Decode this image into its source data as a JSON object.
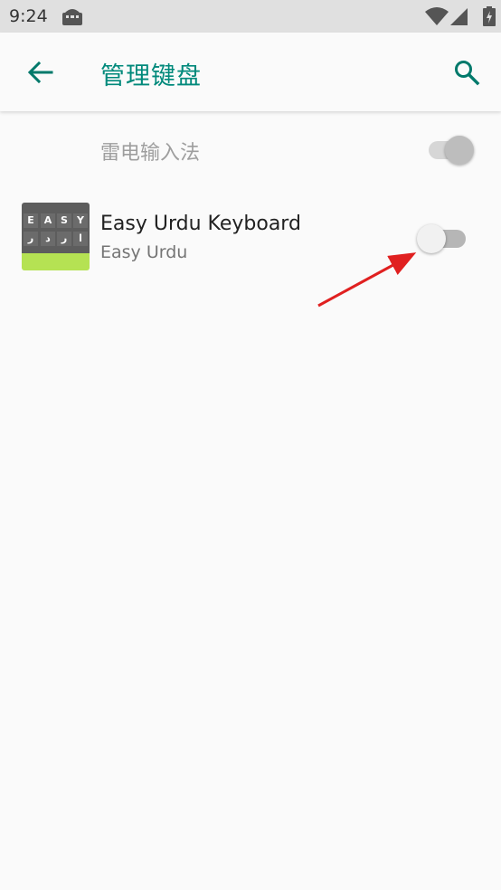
{
  "status_bar": {
    "time": "9:24",
    "icons": [
      "android-icon",
      "wifi-icon",
      "cell-signal-icon",
      "battery-icon"
    ]
  },
  "app_bar": {
    "title": "管理键盘",
    "back_icon": "arrow-back-icon",
    "search_icon": "search-icon"
  },
  "keyboards": [
    {
      "title": "雷电输入法",
      "enabled": true,
      "switch_on": true,
      "switch_disabled": true
    },
    {
      "title": "Easy Urdu Keyboard",
      "summary": "Easy Urdu",
      "enabled": true,
      "switch_on": false,
      "icon": {
        "top_keys": [
          "E",
          "A",
          "S",
          "Y"
        ],
        "bottom_keys": [
          "ر",
          "د",
          "ر",
          "ا"
        ]
      }
    }
  ],
  "colors": {
    "accent": "#00897b",
    "annotation_arrow": "#e02020"
  }
}
